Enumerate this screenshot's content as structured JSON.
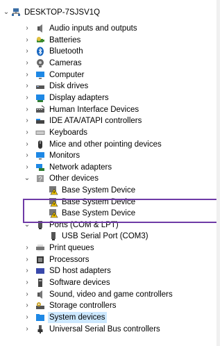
{
  "root": {
    "label": "DESKTOP-7SJSV1Q",
    "icon": "computer-tree-icon"
  },
  "categories": [
    {
      "label": "Audio inputs and outputs",
      "icon": "speaker-icon"
    },
    {
      "label": "Batteries",
      "icon": "battery-icon"
    },
    {
      "label": "Bluetooth",
      "icon": "bluetooth-icon"
    },
    {
      "label": "Cameras",
      "icon": "camera-icon"
    },
    {
      "label": "Computer",
      "icon": "monitor-icon"
    },
    {
      "label": "Disk drives",
      "icon": "disk-drive-icon"
    },
    {
      "label": "Display adapters",
      "icon": "display-adapter-icon"
    },
    {
      "label": "Human Interface Devices",
      "icon": "hid-icon"
    },
    {
      "label": "IDE ATA/ATAPI controllers",
      "icon": "ide-controller-icon"
    },
    {
      "label": "Keyboards",
      "icon": "keyboard-icon"
    },
    {
      "label": "Mice and other pointing devices",
      "icon": "mouse-icon"
    },
    {
      "label": "Monitors",
      "icon": "monitor-icon"
    },
    {
      "label": "Network adapters",
      "icon": "network-adapter-icon"
    },
    {
      "label": "Other devices",
      "icon": "unknown-device-icon"
    },
    {
      "label": "Base System Device",
      "icon": "warning-device-icon"
    },
    {
      "label": "Base System Device",
      "icon": "warning-device-icon"
    },
    {
      "label": "Base System Device",
      "icon": "warning-device-icon"
    },
    {
      "label": "Ports (COM & LPT)",
      "icon": "port-icon"
    },
    {
      "label": "USB Serial Port (COM3)",
      "icon": "port-icon"
    },
    {
      "label": "Print queues",
      "icon": "printer-icon"
    },
    {
      "label": "Processors",
      "icon": "processor-icon"
    },
    {
      "label": "SD host adapters",
      "icon": "sd-adapter-icon"
    },
    {
      "label": "Software devices",
      "icon": "software-device-icon"
    },
    {
      "label": "Sound, video and game controllers",
      "icon": "speaker-icon"
    },
    {
      "label": "Storage controllers",
      "icon": "storage-controller-icon"
    },
    {
      "label": "System devices",
      "icon": "system-folder-icon"
    },
    {
      "label": "Universal Serial Bus controllers",
      "icon": "usb-icon"
    }
  ],
  "colors": {
    "selection": "#cce8ff",
    "highlight_box": "#6e3aa6"
  }
}
